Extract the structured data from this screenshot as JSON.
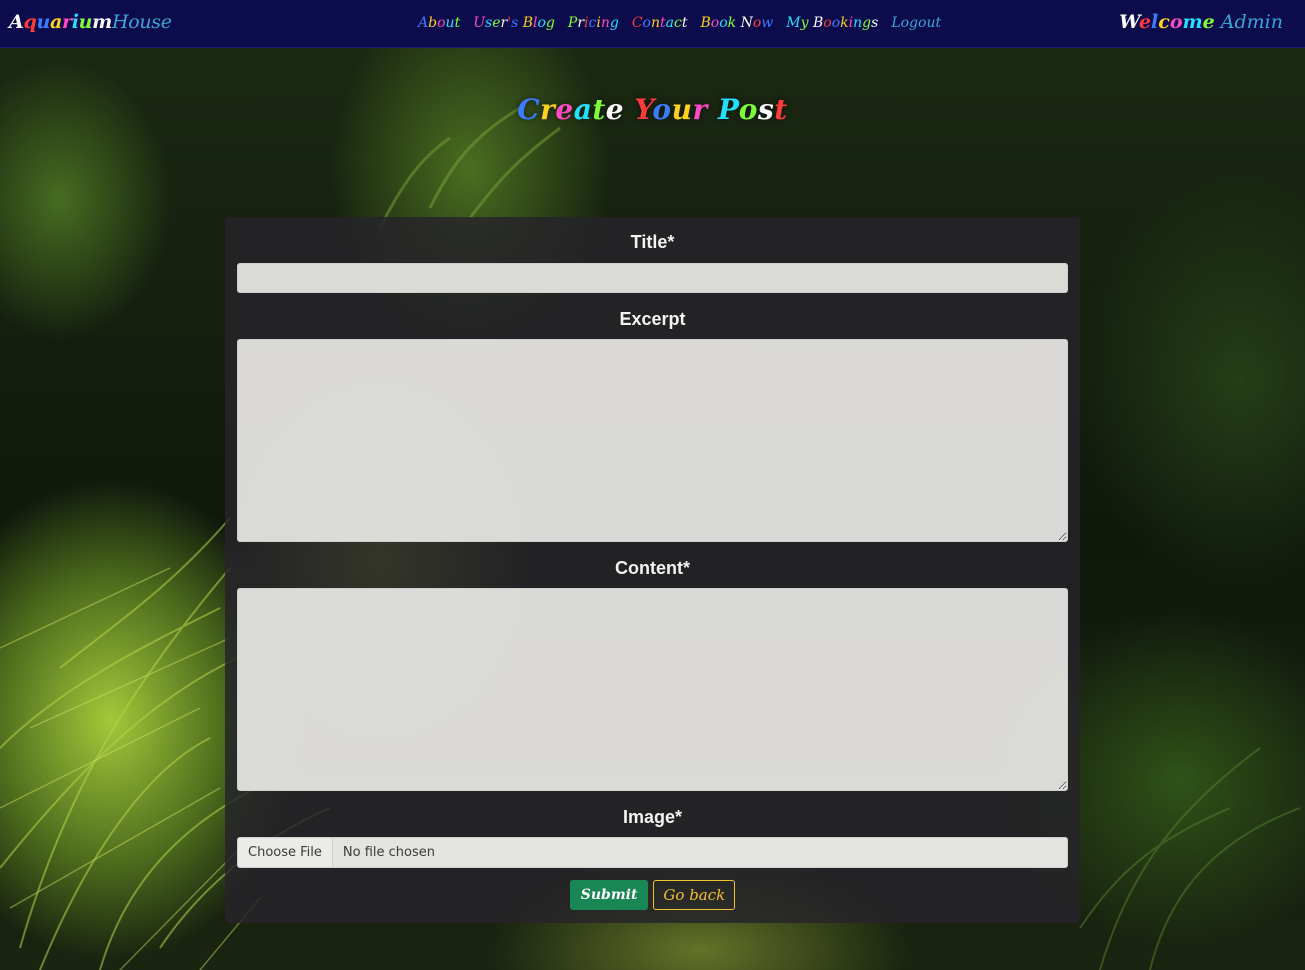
{
  "nav": {
    "brand_main": "Aquarium",
    "brand_sub": "House",
    "links": [
      "About",
      "User's Blog",
      "Pricing",
      "Contact",
      "Book Now",
      "My Bookings",
      "Logout"
    ],
    "welcome_word": "Welcome",
    "welcome_user": "Admin"
  },
  "page": {
    "heading": "Create Your Post"
  },
  "form": {
    "title_label": "Title*",
    "title_value": "",
    "excerpt_label": "Excerpt",
    "excerpt_value": "",
    "content_label": "Content*",
    "content_value": "",
    "image_label": "Image*",
    "file_button_label": "Choose File",
    "file_status": "No file chosen",
    "submit_label": "Submit",
    "back_label": "Go back"
  },
  "colors": {
    "navbar_bg": "#0c0b4c",
    "brand_accent": "#39a6d8",
    "submit_bg": "#198754",
    "back_accent": "#f2c12e",
    "panel_bg": "rgba(38,36,42,0.84)",
    "rainbow": [
      "#ffffff",
      "#ff3b3b",
      "#3b7bff",
      "#ffd21f",
      "#ff49c4",
      "#22e0ff",
      "#7cff3a"
    ]
  },
  "icons": {
    "textarea_resize": "resize-grip-icon"
  }
}
